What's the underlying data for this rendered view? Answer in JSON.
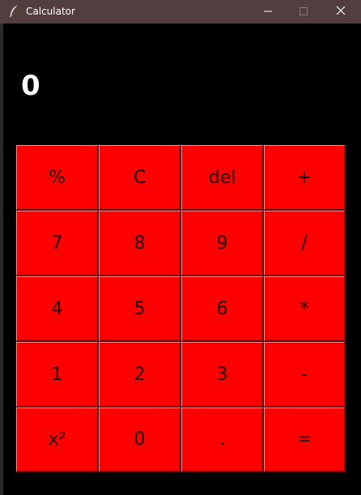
{
  "window": {
    "title": "Calculator",
    "icon": "feather-icon",
    "controls": {
      "minimize_icon": "minimize-icon",
      "maximize_icon": "maximize-icon",
      "close_icon": "close-icon"
    }
  },
  "display": {
    "value": "0"
  },
  "keypad": {
    "rows": [
      [
        "%",
        "C",
        "del",
        "+"
      ],
      [
        "7",
        "8",
        "9",
        "/"
      ],
      [
        "4",
        "5",
        "6",
        "*"
      ],
      [
        "1",
        "2",
        "3",
        "-"
      ],
      [
        "x²",
        "0",
        ".",
        "="
      ]
    ]
  },
  "colors": {
    "titlebar": "#533e3f",
    "background": "#000000",
    "key": "#ff0000",
    "display_text": "#ffffff"
  }
}
